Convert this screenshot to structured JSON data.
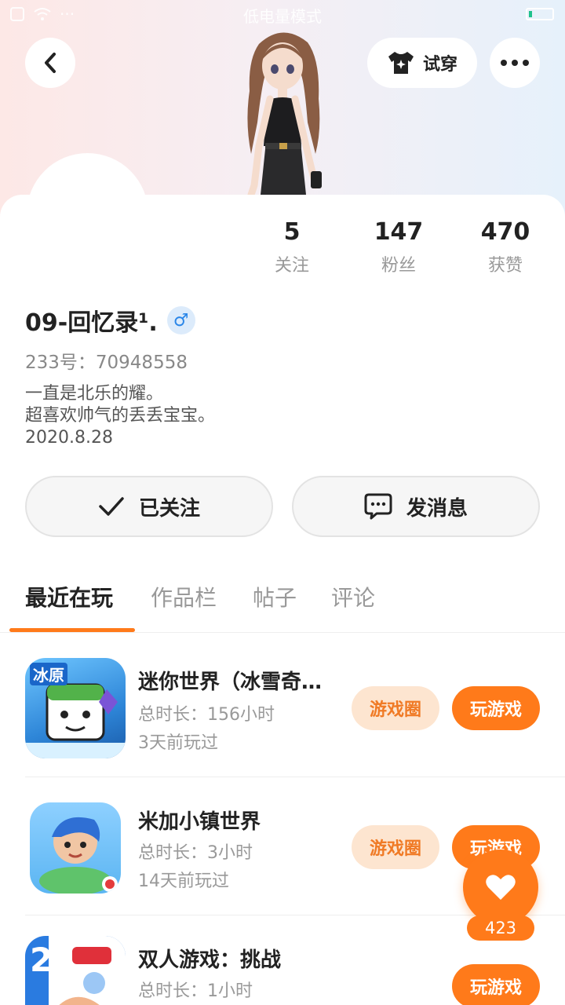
{
  "status_bar": {
    "mode_text": "低电量模式"
  },
  "header": {
    "tryon_label": "试穿"
  },
  "stats": [
    {
      "value": "5",
      "label": "关注"
    },
    {
      "value": "147",
      "label": "粉丝"
    },
    {
      "value": "470",
      "label": "获赞"
    }
  ],
  "profile": {
    "username": "09-回忆录¹.",
    "gender_symbol": "♂",
    "id_text": "233号：70948558",
    "bio_lines": [
      "一直是北乐的耀。",
      "超喜欢帅气的丢丢宝宝。",
      "2020.8.28"
    ]
  },
  "actions": {
    "follow_label": "已关注",
    "message_label": "发消息"
  },
  "tabs": [
    "最近在玩",
    "作品栏",
    "帖子",
    "评论"
  ],
  "games": [
    {
      "title": "迷你世界（冰雪奇缘版）",
      "playtime": "总时长：156小时",
      "last_played": "3天前玩过",
      "circle_label": "游戏圈",
      "play_label": "玩游戏",
      "icon_text": "冰原"
    },
    {
      "title": "米加小镇世界",
      "playtime": "总时长：3小时",
      "last_played": "14天前玩过",
      "circle_label": "游戏圈",
      "play_label": "玩游戏",
      "icon_text": ""
    },
    {
      "title": "双人游戏：挑战",
      "playtime": "总时长：1小时",
      "last_played": "",
      "circle_label": "",
      "play_label": "玩游戏",
      "icon_text": "2"
    }
  ],
  "like": {
    "count": "423"
  },
  "colors": {
    "accent": "#ff7a1a",
    "accent_light": "#fde5d0",
    "gender_blue": "#2a86e8"
  }
}
